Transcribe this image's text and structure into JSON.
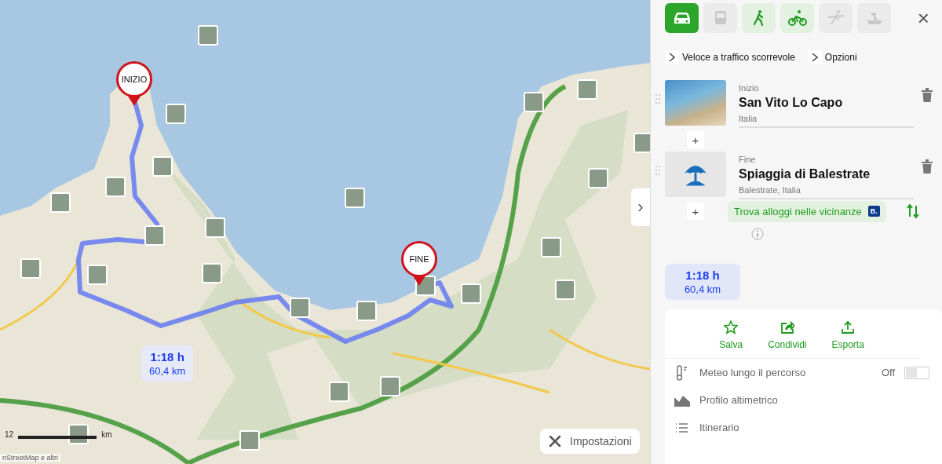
{
  "map": {
    "markers": [
      {
        "kind": "start",
        "label": "INIZIO"
      },
      {
        "kind": "end",
        "label": "FINE"
      }
    ],
    "route_badge": {
      "duration": "1:18 h",
      "distance": "60,4 km"
    },
    "panel_toggle": "›",
    "scale": {
      "number": "12",
      "unit": "km"
    },
    "attribution": "nStreetMap e altri",
    "settings_button": "Impostazioni"
  },
  "panel": {
    "modes": [
      {
        "kind": "car",
        "selected": true,
        "disabled": false
      },
      {
        "kind": "bus",
        "selected": false,
        "disabled": true
      },
      {
        "kind": "walk",
        "selected": false,
        "disabled": false
      },
      {
        "kind": "bike",
        "selected": false,
        "disabled": false
      },
      {
        "kind": "ski",
        "selected": false,
        "disabled": true
      },
      {
        "kind": "boat",
        "selected": false,
        "disabled": true
      }
    ],
    "close": "×",
    "options": [
      "Veloce a traffico scorrevole",
      "Opzioni"
    ],
    "stops": [
      {
        "kind": "photo",
        "role": "Inizio",
        "name": "San Vito Lo Capo",
        "place": "Italia"
      },
      {
        "kind": "beach",
        "role": "Fine",
        "name": "Spiaggia di Balestrate",
        "place": "Balestrate, Italia"
      }
    ],
    "add_stop": "+",
    "lodging": {
      "label": "Trova alloggi nelle vicinanze",
      "badge": "B."
    },
    "summary": {
      "duration": "1:18 h",
      "distance": "60,4 km"
    },
    "actions": [
      {
        "kind": "save",
        "label": "Salva"
      },
      {
        "kind": "share",
        "label": "Condividi"
      },
      {
        "kind": "export",
        "label": "Esporta"
      }
    ],
    "extras": [
      {
        "kind": "weather",
        "label": "Meteo lungo il percorso",
        "state": "Off",
        "on": false
      },
      {
        "kind": "profile",
        "label": "Profilo altimetrico"
      },
      {
        "kind": "list",
        "label": "Itinerario"
      }
    ]
  }
}
